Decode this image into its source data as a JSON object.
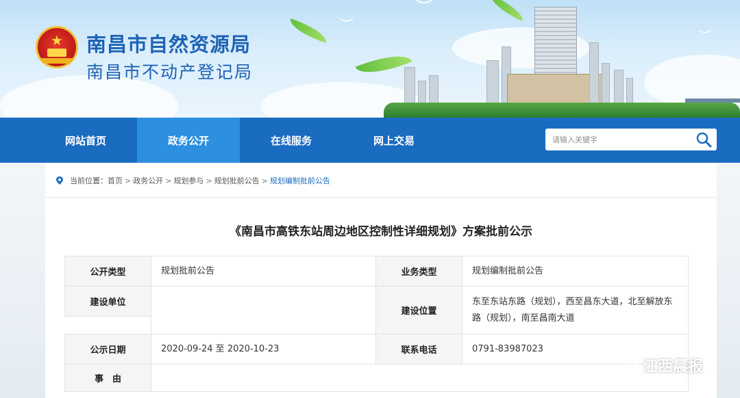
{
  "header": {
    "title": "南昌市自然资源局",
    "subtitle": "南昌市不动产登记局"
  },
  "nav": {
    "items": [
      {
        "label": "网站首页"
      },
      {
        "label": "政务公开"
      },
      {
        "label": "在线服务"
      },
      {
        "label": "网上交易"
      }
    ],
    "active_index": 1,
    "search": {
      "placeholder": "请输入关键字",
      "icon": "search-icon"
    }
  },
  "breadcrumb": {
    "prefix": "当前位置：",
    "items": [
      "首页",
      "政务公开",
      "规划参与",
      "规划批前公告",
      "规划编制批前公告"
    ],
    "separator": ">"
  },
  "document": {
    "title": "《南昌市高铁东站周边地区控制性详细规划》方案批前公示",
    "fields": {
      "type_label": "公开类型",
      "type_value": "规划批前公告",
      "business_label": "业务类型",
      "business_value": "规划编制批前公告",
      "unit_label": "建设单位",
      "unit_value": "",
      "location_label": "建设位置",
      "location_value": "东至东站东路（规划），西至昌东大道，北至解放东路（规划），南至昌南大道",
      "date_label": "公示日期",
      "date_value": "2020-09-24 至 2020-10-23",
      "phone_label": "联系电话",
      "phone_value": "0791-83987023",
      "reason_label": "事　由",
      "reason_value": ""
    }
  },
  "watermark": {
    "text": "江西晨报",
    "icon": "wechat-icon"
  },
  "colors": {
    "brand_blue": "#1a6cc1",
    "nav_active": "#2d8fe0",
    "title_blue": "#1e63b5",
    "label_bg": "#f5f5f5"
  }
}
